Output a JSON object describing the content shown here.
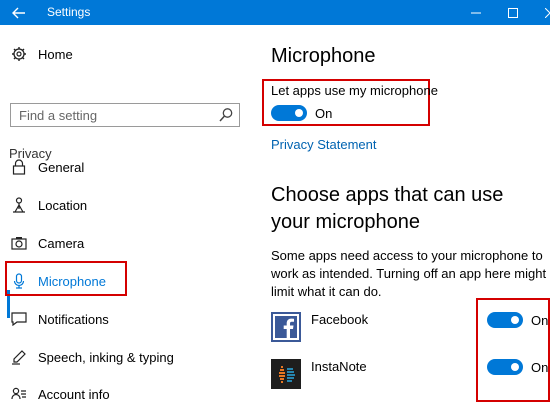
{
  "window": {
    "title": "Settings"
  },
  "sidebar": {
    "home": "Home",
    "search_placeholder": "Find a setting",
    "section": "Privacy",
    "items": [
      {
        "label": "General",
        "icon": "lock-icon"
      },
      {
        "label": "Location",
        "icon": "location-person-icon"
      },
      {
        "label": "Camera",
        "icon": "camera-icon"
      },
      {
        "label": "Microphone",
        "icon": "microphone-icon",
        "selected": true
      },
      {
        "label": "Notifications",
        "icon": "notifications-icon"
      },
      {
        "label": "Speech, inking & typing",
        "icon": "pen-icon"
      },
      {
        "label": "Account info",
        "icon": "account-info-icon"
      }
    ]
  },
  "main": {
    "title": "Microphone",
    "master_toggle": {
      "label": "Let apps use my microphone",
      "state": "On"
    },
    "privacy_link": "Privacy Statement",
    "apps_heading": "Choose apps that can use your microphone",
    "description": "Some apps need access to your microphone to work as intended. Turning off an app here might limit what it can do.",
    "apps": [
      {
        "name": "Facebook",
        "state": "On"
      },
      {
        "name": "InstaNote",
        "state": "On"
      }
    ]
  },
  "colors": {
    "accent": "#0078d7",
    "highlight": "#d40000",
    "link": "#0063b1"
  }
}
